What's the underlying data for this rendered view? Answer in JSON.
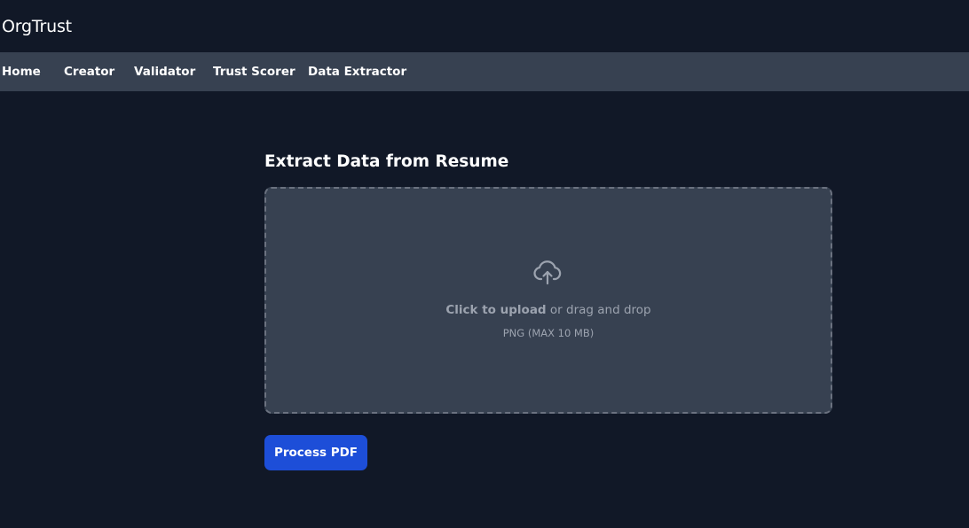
{
  "brand": {
    "name": "OrgTrust"
  },
  "nav": {
    "items": [
      {
        "label": "Home"
      },
      {
        "label": "Creator"
      },
      {
        "label": "Validator"
      },
      {
        "label": "Trust Scorer"
      },
      {
        "label": "Data Extractor"
      }
    ]
  },
  "main": {
    "title": "Extract Data from Resume",
    "dropzone": {
      "icon": "cloud-upload-icon",
      "click_text": "Click to upload",
      "rest_text": " or drag and drop",
      "hint": "PNG (MAX 10 MB)"
    },
    "process_button": "Process PDF"
  },
  "colors": {
    "background": "#111827",
    "navbar": "#374151",
    "dropzone": "#374151",
    "dropzone_border": "#6b7280",
    "muted_text": "#9ca3af",
    "primary_button": "#1d4ed8"
  }
}
